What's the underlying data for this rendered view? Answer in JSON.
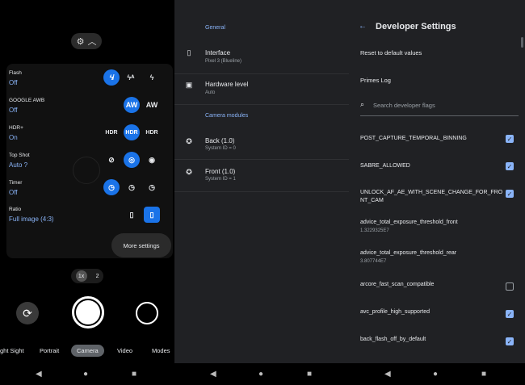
{
  "camera": {
    "settings": [
      {
        "label": "Flash",
        "value": "Off"
      },
      {
        "label": "GOOGLE AWB",
        "value": "Off"
      },
      {
        "label": "HDR+",
        "value": "On"
      },
      {
        "label": "Top Shot",
        "value": "Auto ?"
      },
      {
        "label": "Timer",
        "value": "Off"
      },
      {
        "label": "Ratio",
        "value": "Full image (4:3)"
      }
    ],
    "more_settings": "More settings",
    "zoom": [
      "1x",
      "2"
    ],
    "modes": [
      "ght Sight",
      "Portrait",
      "Camera",
      "Video",
      "Modes"
    ]
  },
  "general": {
    "section_general": "General",
    "interface": {
      "title": "Interface",
      "subtitle": "Pixel 3 (Blueline)"
    },
    "hardware": {
      "title": "Hardware level",
      "subtitle": "Auto"
    },
    "section_modules": "Camera modules",
    "back": {
      "title": "Back (1.0)",
      "subtitle": "System ID = 0"
    },
    "front": {
      "title": "Front (1.0)",
      "subtitle": "System ID = 1"
    }
  },
  "developer": {
    "title": "Developer Settings",
    "reset": "Reset to default values",
    "primes": "Primes Log",
    "search_placeholder": "Search developer flags",
    "flags": [
      {
        "name": "POST_CAPTURE_TEMPORAL_BINNING",
        "checked": true
      },
      {
        "name": "SABRE_ALLOWED",
        "checked": true
      },
      {
        "name": "UNLOCK_AF_AE_WITH_SCENE_CHANGE_FOR_FRONT_CAM",
        "checked": true
      },
      {
        "name": "advice_total_exposure_threshold_front",
        "value": "1.3229325E7"
      },
      {
        "name": "advice_total_exposure_threshold_rear",
        "value": "3.807744E7"
      },
      {
        "name": "arcore_fast_scan_compatible",
        "checked": false
      },
      {
        "name": "avc_profile_high_supported",
        "checked": true
      },
      {
        "name": "back_flash_off_by_default",
        "checked": true
      }
    ]
  },
  "colors": {
    "accent": "#8ab4f8",
    "selected": "#1a73e8",
    "surface": "#202124"
  }
}
